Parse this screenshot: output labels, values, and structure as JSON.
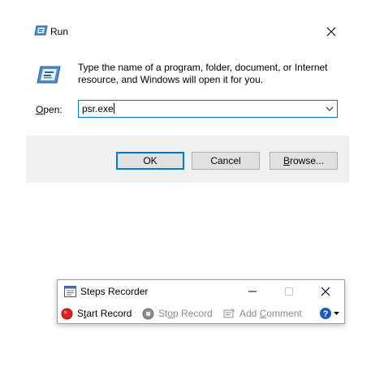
{
  "run": {
    "title": "Run",
    "description": "Type the name of a program, folder, document, or Internet resource, and Windows will open it for you.",
    "open_label_prefix": "",
    "open_label_key": "O",
    "open_label_rest": "pen:",
    "input_value": "psr.exe",
    "ok_label": "OK",
    "cancel_label": "Cancel",
    "browse_key": "B",
    "browse_rest": "rowse..."
  },
  "recorder": {
    "title": "Steps Recorder",
    "start_pre": "S",
    "start_key": "t",
    "start_rest": "art Record",
    "stop_pre": "St",
    "stop_key": "o",
    "stop_rest": "p Record",
    "comment_pre": "Add ",
    "comment_key": "C",
    "comment_rest": "omment"
  },
  "colors": {
    "accent": "#0078d7",
    "record_red": "#d9261c",
    "disabled_text": "#8a8a8a",
    "help_blue": "#1a56c4"
  },
  "icons": [
    "run-app-icon",
    "close-icon",
    "chevron-down-icon",
    "steps-recorder-icon",
    "minimize-icon",
    "maximize-icon",
    "record-icon",
    "stop-icon",
    "comment-icon",
    "help-icon"
  ]
}
